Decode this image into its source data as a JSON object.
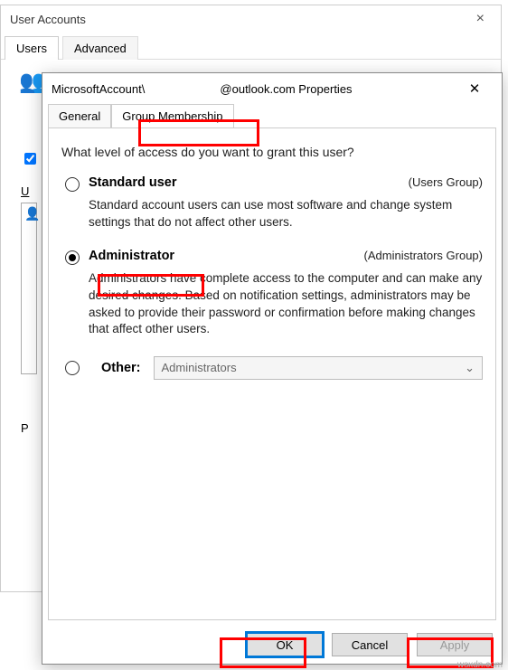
{
  "bg": {
    "title": "User Accounts",
    "tabs": {
      "users": "Users",
      "advanced": "Advanced"
    },
    "u_label": "U",
    "p_label": "P"
  },
  "fg": {
    "title_prefix": "MicrosoftAccount\\",
    "title_suffix": "@outlook.com Properties",
    "tabs": {
      "general": "General",
      "group": "Group Membership"
    },
    "question": "What level of access do you want to grant this user?",
    "standard": {
      "title": "Standard user",
      "group": "(Users Group)",
      "desc": "Standard account users can use most software and change system settings that do not affect other users."
    },
    "admin": {
      "title": "Administrator",
      "group": "(Administrators Group)",
      "desc": "Administrators have complete access to the computer and can make any desired changes. Based on notification settings, administrators may be asked to provide their password or confirmation before making changes that affect other users."
    },
    "other": {
      "title": "Other:",
      "combo": "Administrators"
    },
    "buttons": {
      "ok": "OK",
      "cancel": "Cancel",
      "apply": "Apply"
    }
  },
  "watermark": "wsxdn.com"
}
